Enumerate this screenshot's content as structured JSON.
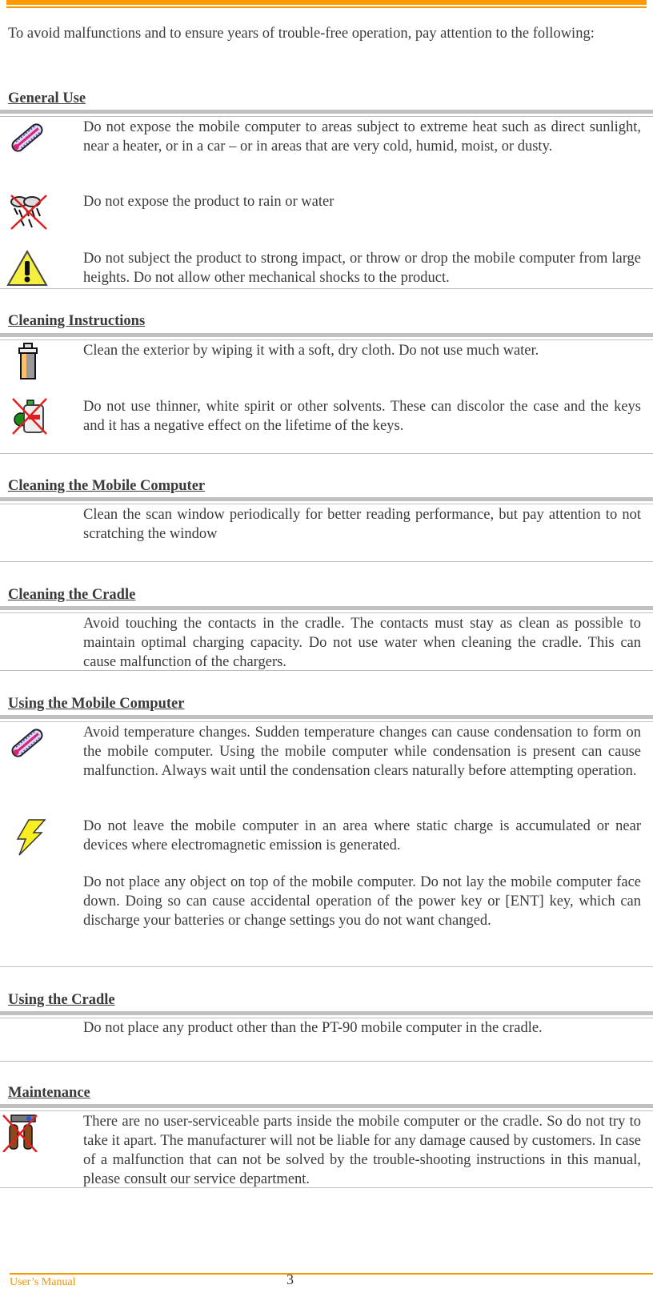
{
  "header": {
    "accent_color": "#ff9900"
  },
  "intro": "To avoid malfunctions and to ensure years of trouble-free operation, pay attention to the following:",
  "sections": [
    {
      "title": "General Use",
      "items": [
        {
          "icon": "thermometer-icon",
          "text": "Do not expose the mobile computer to areas subject to extreme heat such as direct sunlight, near a heater, or in a car – or in areas that are very cold, humid, moist, or dusty."
        },
        {
          "icon": "no-rain-icon",
          "text": "Do not expose the product to rain or water"
        },
        {
          "icon": "warning-icon",
          "text": "Do not subject the product to strong impact, or throw or drop the mobile computer from large heights. Do not allow other mechanical shocks to the product."
        }
      ]
    },
    {
      "title": "Cleaning Instructions",
      "items": [
        {
          "icon": "cloth-jug-icon",
          "text": "Clean the exterior by wiping it with a soft, dry cloth. Do not use much water."
        },
        {
          "icon": "no-solvent-icon",
          "text": "Do not use thinner, white spirit or other solvents. These can discolor the case and the keys and it has a negative effect on the lifetime of the keys."
        }
      ]
    },
    {
      "title": "Cleaning the Mobile Computer",
      "items": [
        {
          "icon": "",
          "text": "Clean the scan window periodically for better reading performance, but pay attention to not scratching the window"
        }
      ]
    },
    {
      "title": "Cleaning the Cradle",
      "items": [
        {
          "icon": "",
          "text": "Avoid touching the contacts in the cradle. The contacts must stay as clean as possible to maintain optimal charging capacity. Do not use water when cleaning the cradle. This can cause malfunction of the chargers."
        }
      ]
    },
    {
      "title": "Using the Mobile Computer",
      "items": [
        {
          "icon": "thermometer-icon",
          "text": "Avoid temperature changes. Sudden temperature changes can cause condensation to form on the mobile computer. Using the mobile computer while condensation is present can cause malfunction. Always wait until the condensation clears naturally before attempting operation."
        },
        {
          "icon": "lightning-icon",
          "text": "Do not leave the mobile computer in an area where static charge is accumulated or near devices where electromagnetic emission is generated."
        },
        {
          "icon": "",
          "text": "Do not place any object on top of the mobile computer. Do not lay the mobile computer face down. Doing so can cause accidental operation of the power key or [ENT] key, which can discharge your batteries or change settings you do not want changed."
        }
      ]
    },
    {
      "title": "Using the Cradle",
      "items": [
        {
          "icon": "",
          "text": "Do not place any product other than the PT-90 mobile computer in the cradle."
        }
      ]
    },
    {
      "title": "Maintenance",
      "items": [
        {
          "icon": "no-tools-icon",
          "text": "There are no user-serviceable parts inside the mobile computer or the cradle. So do not try to take it apart. The manufacturer will not be liable for any damage caused by customers. In case of a malfunction that can not be solved by the trouble-shooting instructions in this manual, please consult our service department."
        }
      ]
    }
  ],
  "footer": {
    "label": "User’s Manual",
    "page_number": "3"
  }
}
